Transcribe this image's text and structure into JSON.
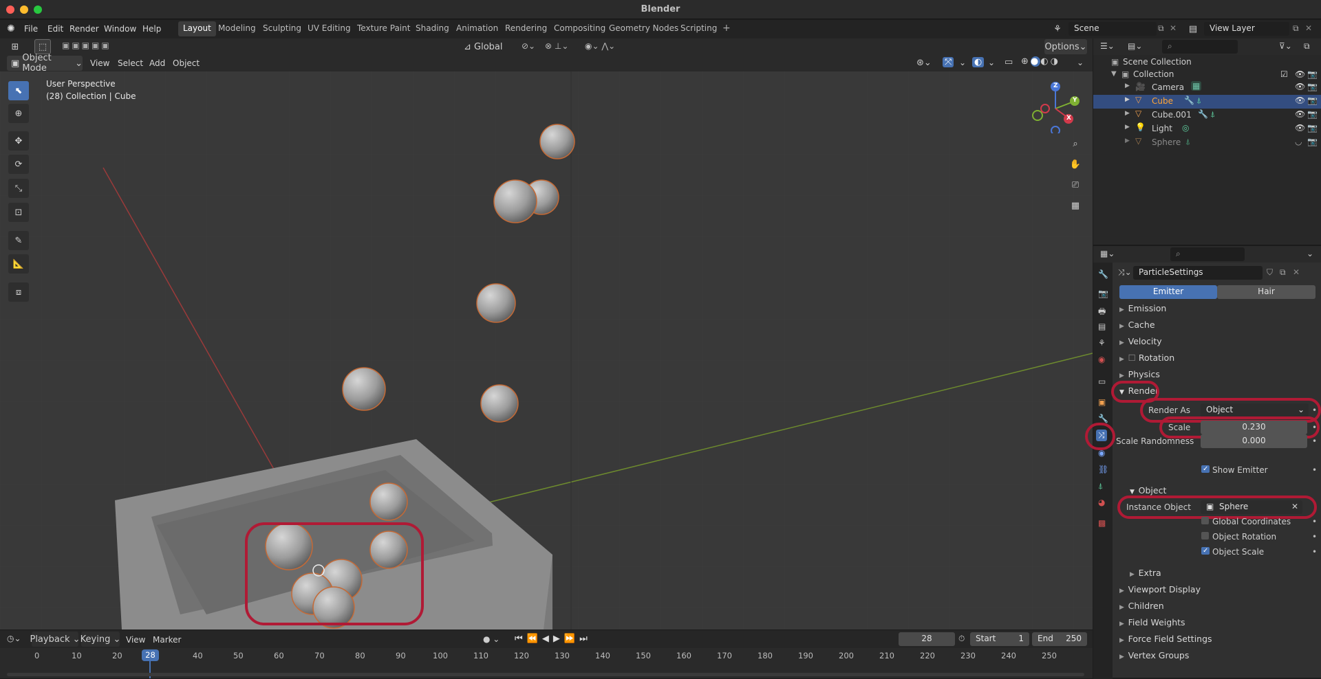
{
  "window": {
    "title": "Blender"
  },
  "menus": [
    "File",
    "Edit",
    "Render",
    "Window",
    "Help"
  ],
  "workspaces": [
    "Layout",
    "Modeling",
    "Sculpting",
    "UV Editing",
    "Texture Paint",
    "Shading",
    "Animation",
    "Rendering",
    "Compositing",
    "Geometry Nodes",
    "Scripting"
  ],
  "scene": {
    "name": "Scene",
    "view_layer": "View Layer"
  },
  "viewport": {
    "mode": "Object Mode",
    "menu": [
      "View",
      "Select",
      "Add",
      "Object"
    ],
    "transform": "Global",
    "options": "Options",
    "perspective": "User Perspective",
    "info": "(28) Collection | Cube",
    "gizmo": {
      "x": "X",
      "y": "Y",
      "z": "Z"
    }
  },
  "outliner": {
    "root": "Scene Collection",
    "collection": "Collection",
    "items": [
      {
        "name": "Camera",
        "selected": false
      },
      {
        "name": "Cube",
        "selected": true
      },
      {
        "name": "Cube.001",
        "selected": false
      },
      {
        "name": "Light",
        "selected": false
      },
      {
        "name": "Sphere",
        "selected": false
      }
    ]
  },
  "properties": {
    "settings_name": "ParticleSettings",
    "tabs": [
      "Emitter",
      "Hair"
    ],
    "panels_top": [
      "Emission",
      "Cache",
      "Velocity",
      "Rotation",
      "Physics"
    ],
    "render": {
      "title": "Render",
      "render_as_label": "Render As",
      "render_as_value": "Object",
      "scale_label": "Scale",
      "scale_value": "0.230",
      "scale_rand_label": "Scale Randomness",
      "scale_rand_value": "0.000",
      "show_emitter": "Show Emitter"
    },
    "object": {
      "title": "Object",
      "instance_label": "Instance Object",
      "instance_value": "Sphere",
      "global_coords": "Global Coordinates",
      "object_rotation": "Object Rotation",
      "object_scale": "Object Scale"
    },
    "extra": "Extra",
    "panels_bottom": [
      "Viewport Display",
      "Children",
      "Field Weights",
      "Force Field Settings",
      "Vertex Groups"
    ]
  },
  "timeline": {
    "menu": [
      "Playback",
      "Keying",
      "View",
      "Marker"
    ],
    "current_frame": "28",
    "start_label": "Start",
    "start": "1",
    "end_label": "End",
    "end": "250",
    "ticks": [
      "0",
      "10",
      "20",
      "28",
      "40",
      "50",
      "60",
      "70",
      "80",
      "90",
      "100",
      "110",
      "120",
      "130",
      "140",
      "150",
      "160",
      "170",
      "180",
      "190",
      "200",
      "210",
      "220",
      "230",
      "240",
      "250"
    ]
  },
  "colors": {
    "accent": "#4772b3",
    "highlight": "#b01a35",
    "selected_text": "#ffa537"
  }
}
